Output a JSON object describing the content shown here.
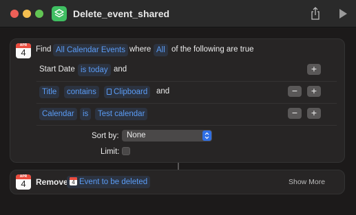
{
  "window": {
    "title": "Delete_event_shared"
  },
  "find_action": {
    "calendar_icon": {
      "month": "APR",
      "day": "4"
    },
    "find_label": "Find",
    "entity_token": "All Calendar Events",
    "where_label": "where",
    "quantifier_token": "All",
    "tail_label": "of the following are true",
    "filters": [
      {
        "field": "Start Date",
        "operator": "is today",
        "value": "",
        "conjunction": "and"
      },
      {
        "field": "Title",
        "operator": "contains",
        "value": "Clipboard",
        "conjunction": "and"
      },
      {
        "field": "Calendar",
        "operator": "is",
        "value": "Test calendar",
        "conjunction": ""
      }
    ],
    "sort_label": "Sort by:",
    "sort_value": "None",
    "limit_label": "Limit:",
    "limit_checked": false
  },
  "remove_action": {
    "calendar_icon": {
      "month": "APR",
      "day": "4"
    },
    "label": "Remove",
    "variable_token": "Event to be deleted",
    "show_more": "Show More"
  },
  "buttons": {
    "add": "+",
    "remove": "−"
  },
  "icons": {
    "app": "shortcuts-icon",
    "share": "share-icon",
    "run": "play-icon",
    "calendar": "calendar-icon",
    "clipboard": "clipboard-icon",
    "sort_stepper": "chevron-up-down-icon"
  },
  "colors": {
    "accent_token": "#5b9cf5",
    "popup_stepper": "#2f6fe4",
    "app_icon": "#3fbf62",
    "calendar_red": "#ea4b3d"
  }
}
